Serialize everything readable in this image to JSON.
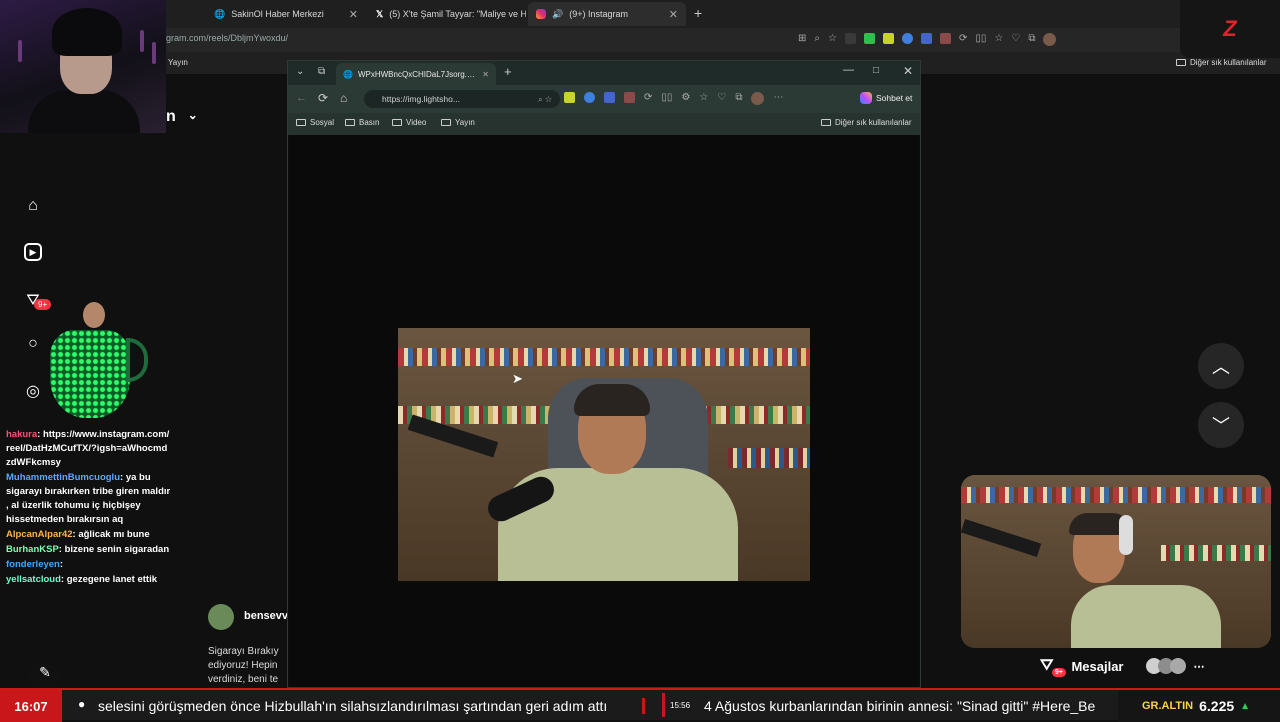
{
  "back_browser": {
    "tabs": [
      {
        "label": "SakinOl Haber Merkezi"
      },
      {
        "label": "(5) X'te Şamil Tayyar: \"Maliye ve H"
      },
      {
        "label": "(9+) Instagram"
      }
    ],
    "url": "gram.com/reels/DbljmYwoxdu/",
    "bookmark_yayin": "Yayın",
    "bookmark_other": "Diğer sık kullanılanlar",
    "username_partial": "n"
  },
  "front_browser": {
    "tab_title": "WPxHWBncQxCHIDaL7Jsorg.png",
    "url": "https://img.lightsho...",
    "copilot_label": "Sohbet et",
    "bookmarks": [
      "Sosyal",
      "Basın",
      "Video",
      "Yayın"
    ],
    "bookmark_other": "Diğer sık kullanılanlar"
  },
  "left_rail": {
    "notif_badge": "9+"
  },
  "chat": [
    {
      "user": "hakura",
      "cls": "u1",
      "text": "https://www.instagram.com/reel/DatHzMCufTX/?igsh=aWhocmdzdWFkcmsy"
    },
    {
      "user": "MuhammettinBumcuoglu",
      "cls": "u2",
      "text": "ya bu sigarayı bırakırken tribe giren maldır , al üzerlik tohumu iç hiçbişey hissetmeden bırakırsın aq"
    },
    {
      "user": "AlpcanAlpar42",
      "cls": "u3",
      "text": "ağlicak mı bune"
    },
    {
      "user": "BurhanKSP",
      "cls": "u4",
      "text": "bizene senin sigaradan"
    },
    {
      "user": "fonderleyen",
      "cls": "u5",
      "text": ""
    },
    {
      "user": "yellsatcloud",
      "cls": "u6",
      "text": "gezegene lanet ettik"
    }
  ],
  "post": {
    "author": "bensevv",
    "caption_lines": [
      "Sigarayı Bırakıy",
      "ediyoruz! Hepin",
      "verdiniz, beni te"
    ]
  },
  "messages_bar": {
    "label": "Mesajlar",
    "badge": "9+"
  },
  "ticker": {
    "time": "16:07",
    "headline_1": "selesini görüşmeden önce Hizbullah'ın silahsızlandırılması şartından geri adım attı",
    "stamp": "15:56",
    "headline_2": "4 Ağustos kurbanlarından birinin annesi: \"Sinad gitti\" #Here_Be",
    "gold_label": "GR.ALTIN",
    "gold_value": "6.225"
  },
  "colors": {
    "accent_red": "#c8161b",
    "gold": "#ffd24a",
    "edge_green": "#2c3a36"
  }
}
